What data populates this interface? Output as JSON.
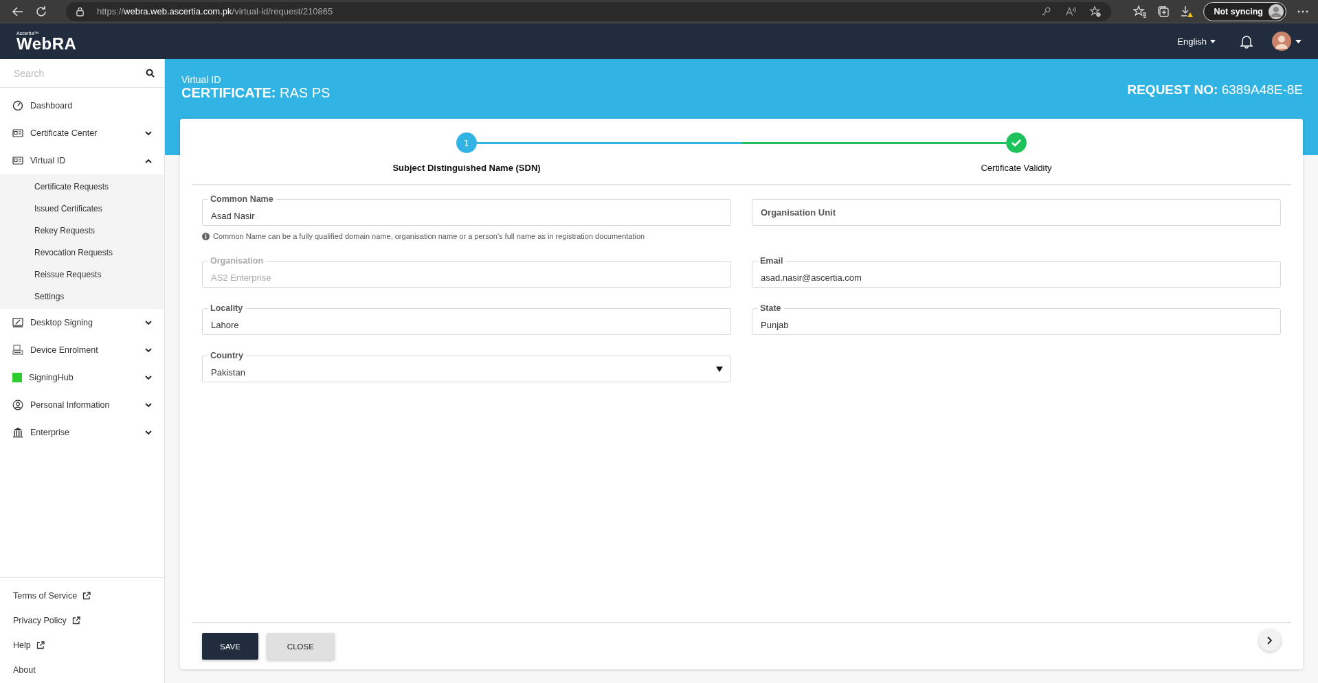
{
  "browser": {
    "url_scheme": "https://",
    "url_host": "webra.web.ascertia.com.pk",
    "url_path": "/virtual-id/request/210865",
    "profile_button": "Not syncing"
  },
  "app_header": {
    "logo_small": "Ascertia™",
    "logo": "WebRA",
    "language": "English"
  },
  "sidebar": {
    "search": {
      "placeholder": "Search"
    },
    "items": [
      {
        "label": "Dashboard"
      },
      {
        "label": "Certificate Center",
        "expanded": false
      },
      {
        "label": "Virtual ID",
        "expanded": true,
        "children": [
          {
            "label": "Certificate Requests"
          },
          {
            "label": "Issued Certificates"
          },
          {
            "label": "Rekey Requests"
          },
          {
            "label": "Revocation Requests"
          },
          {
            "label": "Reissue Requests"
          },
          {
            "label": "Settings"
          }
        ]
      },
      {
        "label": "Desktop Signing",
        "expanded": false
      },
      {
        "label": "Device Enrolment",
        "expanded": false
      },
      {
        "label": "SigningHub",
        "expanded": false
      },
      {
        "label": "Personal Information",
        "expanded": false
      },
      {
        "label": "Enterprise",
        "expanded": false
      }
    ],
    "footer_links": [
      {
        "label": "Terms of Service",
        "external": true
      },
      {
        "label": "Privacy Policy",
        "external": true
      },
      {
        "label": "Help",
        "external": true
      },
      {
        "label": "About",
        "external": false
      }
    ]
  },
  "banner": {
    "subtitle": "Virtual ID",
    "title_label": "CERTIFICATE:",
    "title_value": "RAS PS",
    "request_label": "REQUEST NO:",
    "request_value": "6389A48E-8E"
  },
  "steps": [
    {
      "label": "Subject Distinguished Name (SDN)",
      "number": "1",
      "selected": true,
      "completed": false
    },
    {
      "label": "Certificate Validity",
      "selected": false,
      "completed": true
    }
  ],
  "form_rows": [
    [
      {
        "kind": "input",
        "label": "Common Name",
        "value": "Asad Nasir",
        "disabled": false,
        "hint": "Common Name can be a fully qualified domain name, organisation name or a person's full name as in registration documentation"
      },
      {
        "kind": "input",
        "placeholder": "Organisation Unit",
        "disabled": false
      }
    ],
    [
      {
        "kind": "input",
        "label": "Organisation",
        "value": "AS2 Enterprise",
        "disabled": true
      },
      {
        "kind": "input",
        "label": "Email",
        "value": "asad.nasir@ascertia.com",
        "disabled": false
      }
    ],
    [
      {
        "kind": "input",
        "label": "Locality",
        "value": "Lahore",
        "disabled": false
      },
      {
        "kind": "input",
        "label": "State",
        "value": "Punjab",
        "disabled": false
      }
    ],
    [
      {
        "kind": "select",
        "label": "Country",
        "value": "Pakistan",
        "disabled": false
      }
    ]
  ],
  "buttons": [
    {
      "label": "SAVE",
      "kind": "primary"
    },
    {
      "label": "CLOSE",
      "kind": "secondary"
    }
  ]
}
